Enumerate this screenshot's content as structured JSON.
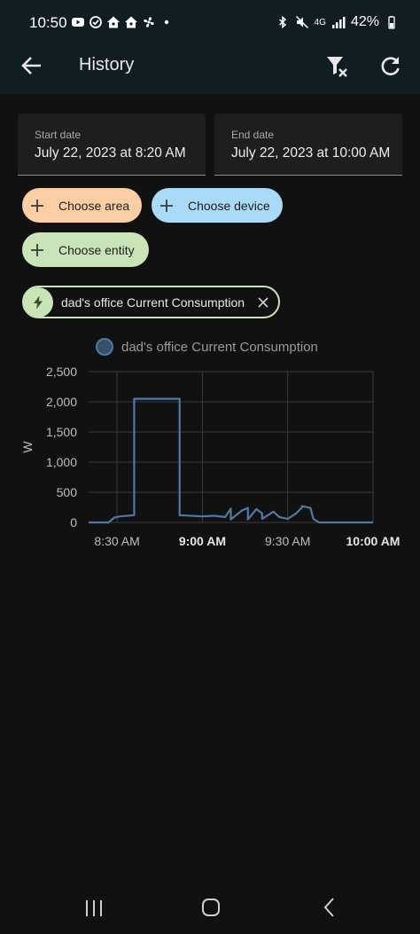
{
  "status_bar": {
    "time": "10:50",
    "network": "4G",
    "battery": "42%"
  },
  "appbar": {
    "title": "History"
  },
  "date_range": {
    "start_label": "Start date",
    "start_value": "July 22, 2023 at 8:20 AM",
    "end_label": "End date",
    "end_value": "July 22, 2023 at 10:00 AM"
  },
  "chips": {
    "area": "Choose area",
    "device": "Choose device",
    "entity": "Choose entity"
  },
  "selected_entity": {
    "label": "dad's office Current Consumption",
    "icon": "flash-icon"
  },
  "colors": {
    "series": "#4f7aa5",
    "area_chip": "#fbcfa3",
    "device_chip": "#a9daf7",
    "entity_chip": "#c9e4b6"
  },
  "chart_data": {
    "type": "line",
    "title": "",
    "xlabel": "",
    "ylabel": "W",
    "ylim": [
      0,
      2500
    ],
    "yticks": [
      "0",
      "500",
      "1,000",
      "1,500",
      "2,000",
      "2,500"
    ],
    "xticks": [
      "8:30 AM",
      "9:00 AM",
      "9:30 AM",
      "10:00 AM"
    ],
    "xlim": [
      "8:20",
      "10:00"
    ],
    "legend": "top-center",
    "grid": true,
    "series": [
      {
        "name": "dad's office Current Consumption",
        "x": [
          "8:20",
          "8:27",
          "8:29",
          "8:31",
          "8:36",
          "8:36",
          "8:44",
          "8:52",
          "8:52",
          "9:00",
          "9:04",
          "9:08",
          "9:10",
          "9:10",
          "9:14",
          "9:16",
          "9:16",
          "9:19",
          "9:21",
          "9:21",
          "9:25",
          "9:27",
          "9:30",
          "9:33",
          "9:35",
          "9:35",
          "9:38",
          "9:39",
          "9:41",
          "10:00"
        ],
        "y": [
          0,
          0,
          80,
          100,
          120,
          2050,
          2050,
          2050,
          120,
          100,
          110,
          90,
          230,
          50,
          200,
          240,
          50,
          220,
          150,
          60,
          180,
          90,
          60,
          150,
          250,
          270,
          240,
          60,
          0,
          0
        ]
      }
    ]
  }
}
